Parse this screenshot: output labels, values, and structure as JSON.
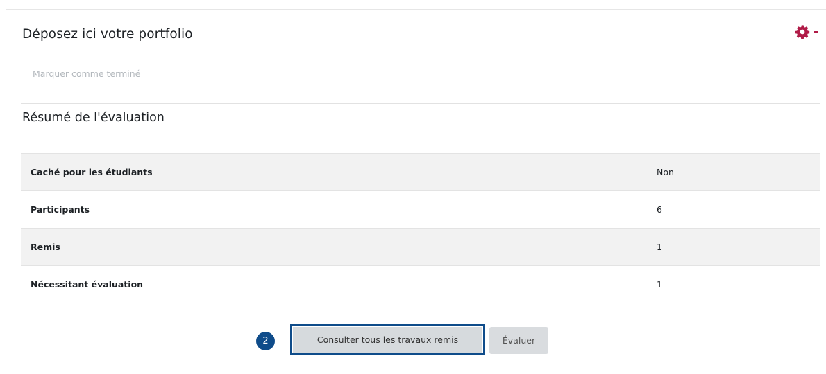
{
  "activity": {
    "title": "Déposez ici votre portfolio",
    "settings_icon": "gear-icon",
    "mark_complete_label": "Marquer comme terminé"
  },
  "summary": {
    "title": "Résumé de l'évaluation",
    "rows": [
      {
        "label": "Caché pour les étudiants",
        "value": "Non"
      },
      {
        "label": "Participants",
        "value": "6"
      },
      {
        "label": "Remis",
        "value": "1"
      },
      {
        "label": "Nécessitant évaluation",
        "value": "1"
      }
    ]
  },
  "actions": {
    "step_number": "2",
    "view_all_label": "Consulter tous les travaux remis",
    "grade_label": "Évaluer"
  },
  "colors": {
    "accent": "#b01b47",
    "highlight": "#0f4c8a",
    "muted_text": "#b3b8bd",
    "row_shade": "#f2f2f2"
  }
}
